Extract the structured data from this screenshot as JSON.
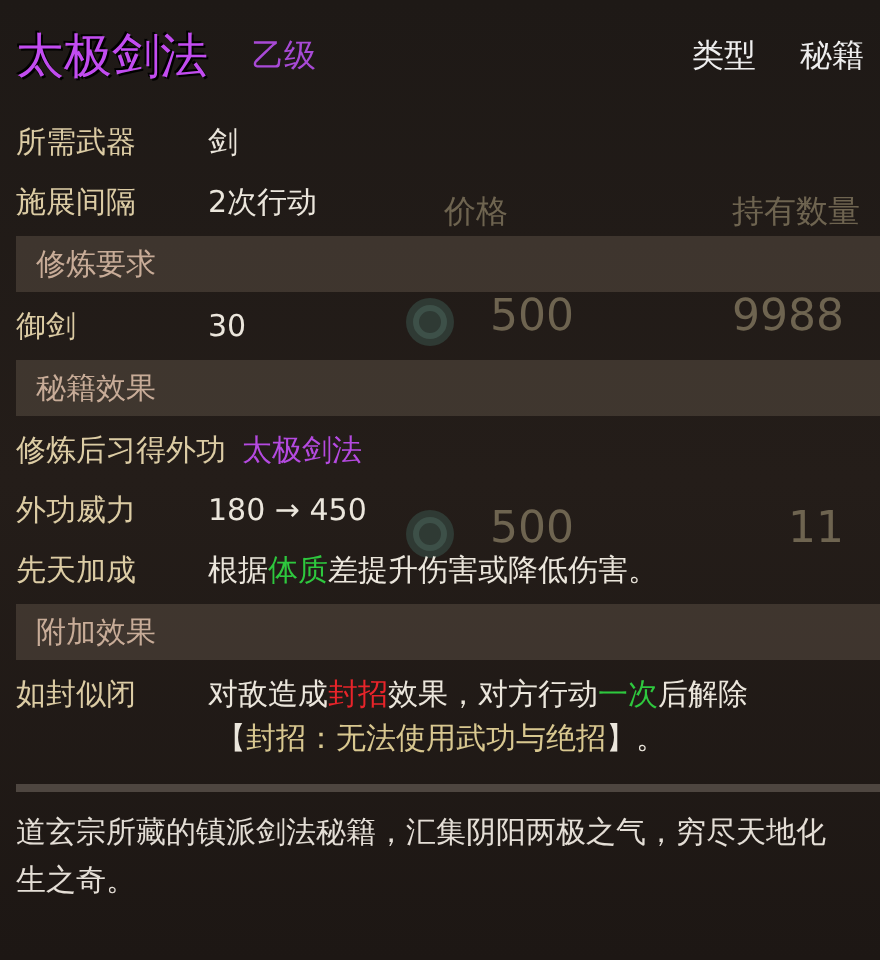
{
  "title": {
    "name": "太极剑法",
    "grade": "乙级",
    "type_label": "类型",
    "type_value": "秘籍"
  },
  "background_table": {
    "columns": [
      "价格",
      "持有数量"
    ],
    "rows": [
      {
        "price": "500",
        "quantity": "9988"
      },
      {
        "price": "500",
        "quantity": "11"
      }
    ]
  },
  "entries": [
    {
      "kind": "row",
      "label": "所需武器",
      "lines": [
        [
          {
            "text": "剑",
            "kind": "plain"
          }
        ]
      ]
    },
    {
      "kind": "row",
      "label": "施展间隔",
      "lines": [
        [
          {
            "text": "2次行动",
            "kind": "plain"
          }
        ]
      ]
    },
    {
      "kind": "header",
      "title": "修炼要求"
    },
    {
      "kind": "row",
      "label": "御剑",
      "lines": [
        [
          {
            "text": "30",
            "kind": "plain"
          }
        ]
      ]
    },
    {
      "kind": "header",
      "title": "秘籍效果"
    },
    {
      "kind": "row",
      "label": "修炼后习得外功",
      "lines": [
        [
          {
            "text": "太极剑法",
            "kind": "skill"
          }
        ]
      ]
    },
    {
      "kind": "row",
      "label": "外功威力",
      "lines": [
        [
          {
            "text": "180 → 450",
            "kind": "plain"
          }
        ]
      ]
    },
    {
      "kind": "row",
      "label": "先天加成",
      "lines": [
        [
          {
            "text": "根据",
            "kind": "plain"
          },
          {
            "text": "体质",
            "kind": "good"
          },
          {
            "text": "差提升伤害或降低伤害。",
            "kind": "plain"
          }
        ]
      ]
    },
    {
      "kind": "header",
      "title": "附加效果"
    },
    {
      "kind": "row",
      "label": "如封似闭",
      "lines": [
        [
          {
            "text": "对敌造成",
            "kind": "plain"
          },
          {
            "text": "封招",
            "kind": "bad"
          },
          {
            "text": "效果，对方行动",
            "kind": "plain"
          },
          {
            "text": "一次",
            "kind": "good"
          },
          {
            "text": "后解除",
            "kind": "plain"
          }
        ],
        [
          {
            "text": "【",
            "kind": "plain"
          },
          {
            "text": "封招：无法使用武功与绝招",
            "kind": "note"
          },
          {
            "text": "】。",
            "kind": "plain"
          }
        ]
      ]
    }
  ],
  "description": "道玄宗所藏的镇派剑法秘籍，汇集阴阳两极之气，穷尽天地化生之奇。"
}
